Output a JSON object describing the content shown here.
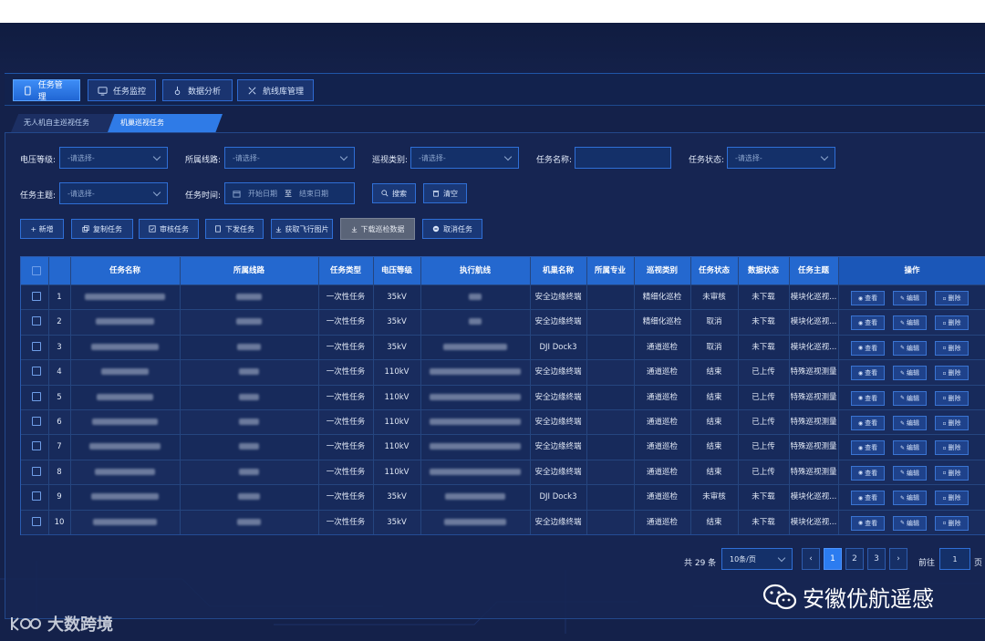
{
  "nav": {
    "tabs": [
      {
        "label": "任务管理",
        "icon": "phone-icon",
        "active": true
      },
      {
        "label": "任务监控",
        "icon": "monitor-icon",
        "active": false
      },
      {
        "label": "数据分析",
        "icon": "pin-icon",
        "active": false
      },
      {
        "label": "航线库管理",
        "icon": "route-icon",
        "active": false
      }
    ]
  },
  "subtabs": [
    "无人机自主巡视任务",
    "机巢巡视任务"
  ],
  "filters": {
    "voltage_label": "电压等级:",
    "voltage_placeholder": "-请选择-",
    "line_label": "所属线路:",
    "line_placeholder": "-请选择-",
    "patrol_type_label": "巡视类别:",
    "patrol_type_placeholder": "-请选择-",
    "task_name_label": "任务名称:",
    "task_status_label": "任务状态:",
    "task_status_placeholder": "-请选择-",
    "task_topic_label": "任务主题:",
    "task_topic_placeholder": "-请选择-",
    "task_time_label": "任务时间:",
    "start_date": "开始日期",
    "to": "至",
    "end_date": "结束日期",
    "search": "搜索",
    "clear": "清空"
  },
  "actions": {
    "add": "+ 新增",
    "copy": "复制任务",
    "review": "审核任务",
    "dispatch": "下发任务",
    "fetch_images": "获取飞行图片",
    "download_data": "下载巡检数据",
    "cancel": "取消任务"
  },
  "table": {
    "headers": {
      "name": "任务名称",
      "line": "所属线路",
      "type": "任务类型",
      "voltage": "电压等级",
      "route": "执行航线",
      "device": "机巢名称",
      "profession": "所属专业",
      "category": "巡视类别",
      "status": "任务状态",
      "data_status": "数据状态",
      "topic": "任务主题",
      "ops": "操作"
    },
    "op_labels": {
      "view": "查看",
      "edit": "编辑",
      "delete": "删除"
    },
    "rows": [
      {
        "no": "1",
        "type": "一次性任务",
        "voltage": "35kV",
        "device": "安全边缘终端",
        "category": "精细化巡检",
        "status": "未审核",
        "data": "未下载",
        "topic": "模块化巡视..."
      },
      {
        "no": "2",
        "type": "一次性任务",
        "voltage": "35kV",
        "device": "安全边缘终端",
        "category": "精细化巡检",
        "status": "取消",
        "data": "未下载",
        "topic": "模块化巡视..."
      },
      {
        "no": "3",
        "type": "一次性任务",
        "voltage": "35kV",
        "device": "DJI Dock3",
        "category": "通道巡检",
        "status": "取消",
        "data": "未下载",
        "topic": "模块化巡视..."
      },
      {
        "no": "4",
        "type": "一次性任务",
        "voltage": "110kV",
        "device": "安全边缘终端",
        "category": "通道巡检",
        "status": "结束",
        "data": "已上传",
        "topic": "特殊巡视测量"
      },
      {
        "no": "5",
        "type": "一次性任务",
        "voltage": "110kV",
        "device": "安全边缘终端",
        "category": "通道巡检",
        "status": "结束",
        "data": "已上传",
        "topic": "特殊巡视测量"
      },
      {
        "no": "6",
        "type": "一次性任务",
        "voltage": "110kV",
        "device": "安全边缘终端",
        "category": "通道巡检",
        "status": "结束",
        "data": "已上传",
        "topic": "特殊巡视测量"
      },
      {
        "no": "7",
        "type": "一次性任务",
        "voltage": "110kV",
        "device": "安全边缘终端",
        "category": "通道巡检",
        "status": "结束",
        "data": "已上传",
        "topic": "特殊巡视测量"
      },
      {
        "no": "8",
        "type": "一次性任务",
        "voltage": "110kV",
        "device": "安全边缘终端",
        "category": "通道巡检",
        "status": "结束",
        "data": "已上传",
        "topic": "特殊巡视测量"
      },
      {
        "no": "9",
        "type": "一次性任务",
        "voltage": "35kV",
        "device": "DJI Dock3",
        "category": "通道巡检",
        "status": "未审核",
        "data": "未下载",
        "topic": "模块化巡视..."
      },
      {
        "no": "10",
        "type": "一次性任务",
        "voltage": "35kV",
        "device": "安全边缘终端",
        "category": "通道巡检",
        "status": "结束",
        "data": "未下载",
        "topic": "模块化巡视..."
      }
    ]
  },
  "pagination": {
    "total": "共 29 条",
    "page_size": "10条/页",
    "pages": [
      "1",
      "2",
      "3"
    ],
    "goto_label": "前往",
    "goto_value": "1",
    "page_suffix": "页"
  },
  "watermarks": {
    "left": "大数跨境",
    "right": "安徽优航遥感"
  },
  "colors": {
    "background": "#14214a",
    "accent": "#2c7cf0",
    "header": "#2468cf"
  }
}
